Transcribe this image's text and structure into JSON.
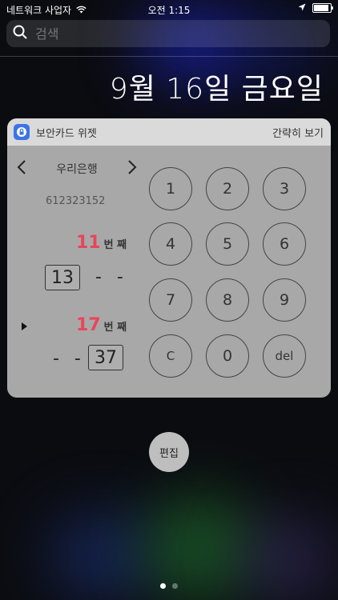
{
  "status": {
    "carrier": "네트워크 사업자",
    "time": "오전 1:15"
  },
  "search": {
    "placeholder": "검색"
  },
  "date": "9월 16일 금요일",
  "widget": {
    "title": "보안카드 위젯",
    "more_label": "간략히 보기",
    "bank": "우리은행",
    "account": "612323152",
    "first": {
      "index": "11",
      "label": "번 째",
      "value": "13",
      "missing": "- -"
    },
    "second": {
      "index": "17",
      "label": "번 째",
      "value": "37",
      "missing": "- -"
    },
    "keypad": [
      "1",
      "2",
      "3",
      "4",
      "5",
      "6",
      "7",
      "8",
      "9",
      "C",
      "0",
      "del"
    ],
    "accent_color": "#e8455a"
  },
  "edit_label": "편집",
  "page_dots": {
    "count": 2,
    "active": 0
  }
}
